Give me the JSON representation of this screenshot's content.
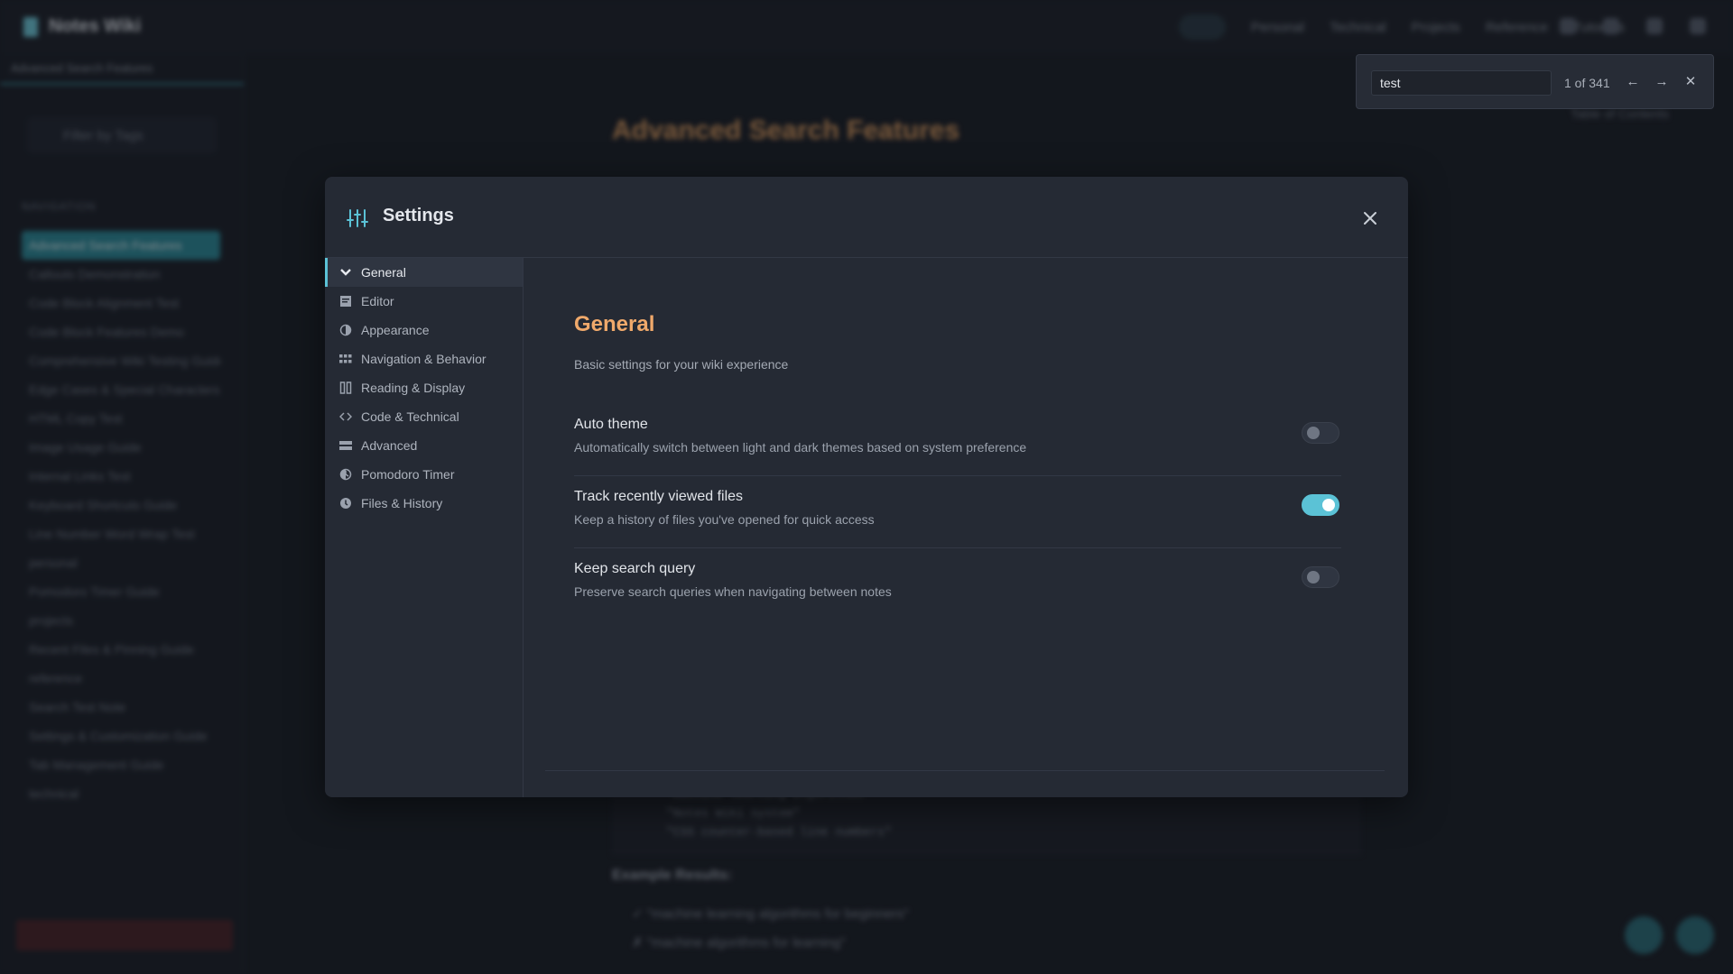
{
  "background": {
    "app_title": "Notes Wiki",
    "tab_label": "Advanced Search Features",
    "topnav": [
      "Personal",
      "Technical",
      "Projects",
      "Reference",
      "Tutorials"
    ],
    "filter_placeholder": "Filter by Tags",
    "nav_heading": "NAVIGATION",
    "nav_items": [
      "Advanced Search Features",
      "Callouts Demonstration",
      "Code Block Alignment Test",
      "Code Block Features Demo",
      "Comprehensive Wiki Testing Guide",
      "Edge Cases & Special Characters Test",
      "HTML Copy Test",
      "Image Usage Guide",
      "Internal Links Test",
      "Keyboard Shortcuts Guide",
      "Line Number Word Wrap Test",
      "personal",
      "Pomodoro Timer Guide",
      "projects",
      "Recent Files & Pinning Guide",
      "reference",
      "Search Test Note",
      "Settings & Customization Guide",
      "Tab Management Guide",
      "technical"
    ],
    "page_title": "Advanced Search Features",
    "toc_label": "Table of Contents",
    "code_lines": [
      "\"machine learning algorithms\"",
      "\"Notes Wiki system\"",
      "\"CSS counter-based line numbers\""
    ],
    "example_heading": "Example Results:",
    "bullets": [
      "✓ \"machine learning algorithms for beginners\"",
      "✗ \"machine algorithms for learning\""
    ]
  },
  "findbar": {
    "query": "test",
    "count": "1 of 341"
  },
  "modal": {
    "title": "Settings",
    "nav": [
      {
        "label": "General",
        "icon": "chevron-down-icon",
        "active": true
      },
      {
        "label": "Editor",
        "icon": "editor-icon"
      },
      {
        "label": "Appearance",
        "icon": "contrast-icon"
      },
      {
        "label": "Navigation & Behavior",
        "icon": "grid-icon"
      },
      {
        "label": "Reading & Display",
        "icon": "columns-icon"
      },
      {
        "label": "Code & Technical",
        "icon": "code-icon"
      },
      {
        "label": "Advanced",
        "icon": "layers-icon"
      },
      {
        "label": "Pomodoro Timer",
        "icon": "timer-icon"
      },
      {
        "label": "Files & History",
        "icon": "history-icon"
      }
    ],
    "section": {
      "title": "General",
      "description": "Basic settings for your wiki experience",
      "settings": [
        {
          "title": "Auto theme",
          "description": "Automatically switch between light and dark themes based on system preference",
          "enabled": false
        },
        {
          "title": "Track recently viewed files",
          "description": "Keep a history of files you've opened for quick access",
          "enabled": true
        },
        {
          "title": "Keep search query",
          "description": "Preserve search queries when navigating between notes",
          "enabled": false
        }
      ]
    }
  },
  "colors": {
    "accent": "#5bc2d6",
    "section_title": "#f0a96b",
    "modal_bg": "#252a34"
  }
}
